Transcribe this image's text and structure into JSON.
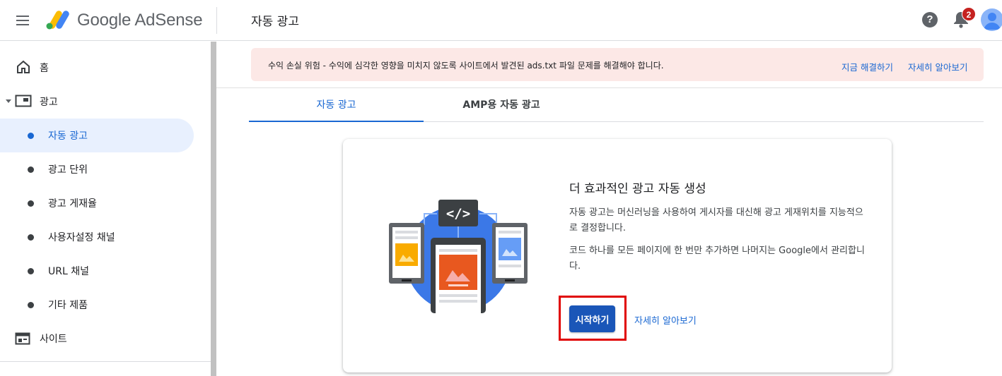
{
  "header": {
    "app_name": "Google AdSense",
    "page_title": "자동 광고",
    "help_glyph": "?",
    "notification_count": "2",
    "menu_icon": "hamburger-menu-icon",
    "logo_colors": [
      "#fbbc04",
      "#34a853",
      "#4285f4"
    ]
  },
  "sidebar": {
    "items": [
      {
        "label": "홈",
        "icon": "home-icon"
      },
      {
        "label": "광고",
        "icon": "ads-icon"
      },
      {
        "label": "자동 광고",
        "active": true
      },
      {
        "label": "광고 단위"
      },
      {
        "label": "광고 게재율"
      },
      {
        "label": "사용자설정 채널"
      },
      {
        "label": "URL 채널"
      },
      {
        "label": "기타 제품"
      },
      {
        "label": "사이트",
        "icon": "site-icon"
      }
    ]
  },
  "alert": {
    "message": "수익 손실 위험 - 수익에 심각한 영향을 미치지 않도록 사이트에서 발견된 ads.txt 파일 문제를 해결해야 합니다.",
    "fix_now": "지금 해결하기",
    "learn_more": "자세히 알아보기"
  },
  "tabs": [
    {
      "label": "자동 광고",
      "active": true
    },
    {
      "label": "AMP용 자동 광고",
      "active": false
    }
  ],
  "card": {
    "title": "더 효과적인 광고 자동 생성",
    "desc1": "자동 광고는 머신러닝을 사용하여 게시자를 대신해 광고 게재위치를 지능적으로 결정합니다.",
    "desc2": "코드 하나를 모든 페이지에 한 번만 추가하면 나머지는 Google에서 관리합니다.",
    "code_glyph": "</>",
    "start_button": "시작하기",
    "learn_more": "자세히 알아보기"
  },
  "colors": {
    "accent": "#1967d2",
    "active_nav_bg": "#e8f0fe",
    "alert_bg": "#fce8e6",
    "start_button_bg": "#1a56b8",
    "highlight_outline": "#e00000",
    "badge": "#c5221f"
  }
}
